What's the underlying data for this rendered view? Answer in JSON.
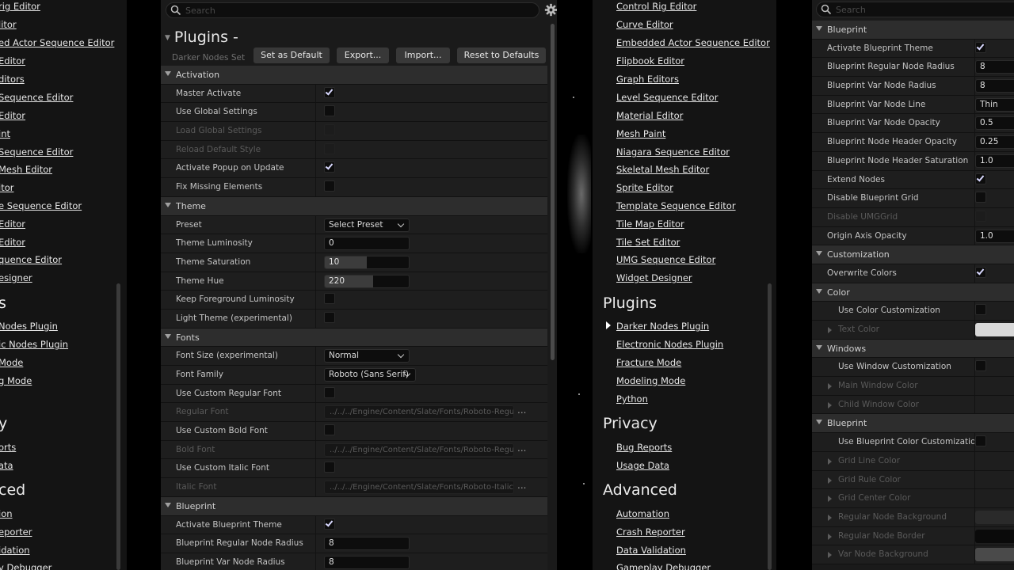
{
  "left_nav": {
    "links_top": [
      "rig Editor",
      "litor",
      "ed Actor Sequence Editor",
      "Editor",
      "ditors",
      "Sequence Editor",
      "Editor",
      "int",
      "Sequence Editor",
      "Mesh Editor",
      "itor",
      "e Sequence Editor",
      "Editor",
      "Editor",
      "quence Editor",
      "esigner"
    ],
    "section_plugins": "s",
    "links_plugins": [
      "Nodes Plugin",
      "ic Nodes Plugin",
      "Mode",
      "g Mode"
    ],
    "section_privacy": "y",
    "links_privacy": [
      "orts",
      "ata"
    ],
    "section_advanced": "ced",
    "links_advanced": [
      "ion",
      "eporter",
      "idation",
      "y Debugger"
    ]
  },
  "mid": {
    "search_placeholder": "Search",
    "title": "Plugins -",
    "subtitle": "Darker Nodes Settings",
    "buttons": {
      "set_default": "Set as Default",
      "export": "Export...",
      "import": "Import...",
      "reset": "Reset to Defaults"
    },
    "activation": {
      "header": "Activation",
      "master_activate": "Master Activate",
      "use_global": "Use Global Settings",
      "load_global": "Load Global Settings",
      "reload_default": "Reload Default Style",
      "activate_popup": "Activate Popup on Update",
      "fix_missing": "Fix Missing Elements"
    },
    "theme": {
      "header": "Theme",
      "preset_label": "Preset",
      "preset_value": "Select Preset",
      "luminosity_label": "Theme Luminosity",
      "luminosity_value": "0",
      "luminosity_fraction": 0.0,
      "saturation_label": "Theme Saturation",
      "saturation_value": "10",
      "saturation_fraction": 0.5,
      "hue_label": "Theme Hue",
      "hue_value": "220",
      "hue_fraction": 0.58,
      "keep_fg": "Keep Foreground Luminosity",
      "light_theme": "Light Theme (experimental)"
    },
    "fonts": {
      "header": "Fonts",
      "size_label": "Font Size (experimental)",
      "size_value": "Normal",
      "family_label": "Font Family",
      "family_value": "Roboto (Sans Serif)",
      "use_regular": "Use Custom Regular Font",
      "regular_label": "Regular Font",
      "regular_path": "../../../Engine/Content/Slate/Fonts/Roboto-Regular.ttf",
      "use_bold": "Use Custom Bold Font",
      "bold_label": "Bold Font",
      "bold_path": "../../../Engine/Content/Slate/Fonts/Roboto-Regular.ttf",
      "use_italic": "Use Custom Italic Font",
      "italic_label": "Italic Font",
      "italic_path": "../../../Engine/Content/Slate/Fonts/Roboto-Italic.ttf",
      "dots": "..."
    },
    "blueprint": {
      "header": "Blueprint",
      "activate_theme": "Activate Blueprint Theme",
      "regular_radius_label": "Blueprint Regular Node Radius",
      "regular_radius_value": "8",
      "var_radius_label": "Blueprint Var Node Radius",
      "var_radius_value": "8"
    }
  },
  "links": {
    "top": [
      "Control Rig Editor",
      "Curve Editor",
      "Embedded Actor Sequence Editor",
      "Flipbook Editor",
      "Graph Editors",
      "Level Sequence Editor",
      "Material Editor",
      "Mesh Paint",
      "Niagara Sequence Editor",
      "Skeletal Mesh Editor",
      "Sprite Editor",
      "Template Sequence Editor",
      "Tile Map Editor",
      "Tile Set Editor",
      "UMG Sequence Editor",
      "Widget Designer"
    ],
    "section_plugins": "Plugins",
    "plugins": [
      "Darker Nodes Plugin",
      "Electronic Nodes Plugin",
      "Fracture Mode",
      "Modeling Mode",
      "Python"
    ],
    "section_privacy": "Privacy",
    "privacy": [
      "Bug Reports",
      "Usage Data"
    ],
    "section_advanced": "Advanced",
    "advanced": [
      "Automation",
      "Crash Reporter",
      "Data Validation",
      "Gameplay Debugger"
    ]
  },
  "right": {
    "search_placeholder": "Search",
    "blueprint_header": "Blueprint",
    "activate_theme": "Activate Blueprint Theme",
    "reg_radius_label": "Blueprint Regular Node Radius",
    "reg_radius_value": "8",
    "var_radius_label": "Blueprint Var Node Radius",
    "var_radius_value": "8",
    "var_line_label": "Blueprint Var Node Line",
    "var_line_value": "Thin",
    "var_opacity_label": "Blueprint Var Node Opacity",
    "var_opacity_value": "0.5",
    "header_opacity_label": "Blueprint Node Header Opacity",
    "header_opacity_value": "0.25",
    "header_sat_label": "Blueprint Node Header Saturation",
    "header_sat_value": "1.0",
    "extend_nodes": "Extend Nodes",
    "disable_grid": "Disable Blueprint Grid",
    "disable_umg": "Disable UMGGrid",
    "origin_opacity_label": "Origin Axis Opacity",
    "origin_opacity_value": "1.0",
    "customization_header": "Customization",
    "overwrite_colors": "Overwrite Colors",
    "color_header": "Color",
    "use_color_cust": "Use Color Customization",
    "text_color": "Text Color",
    "windows_header": "Windows",
    "use_window_cust": "Use Window Customization",
    "main_window_color": "Main Window Color",
    "child_window_color": "Child Window Color",
    "bp_color_header": "Blueprint",
    "use_bp_color_cust": "Use Blueprint Color Customization",
    "grid_line": "Grid Line Color",
    "grid_rule": "Grid Rule Color",
    "grid_center": "Grid Center Color",
    "reg_node_bg": "Regular Node Background",
    "reg_node_border": "Regular Node Border",
    "var_node_bg": "Var Node Background"
  },
  "colors": {
    "panel": "#1a1a1a",
    "category_row": "#2d2d2d",
    "check": "#d9d9ff",
    "text_color_swatch": "#d8d8d8"
  }
}
